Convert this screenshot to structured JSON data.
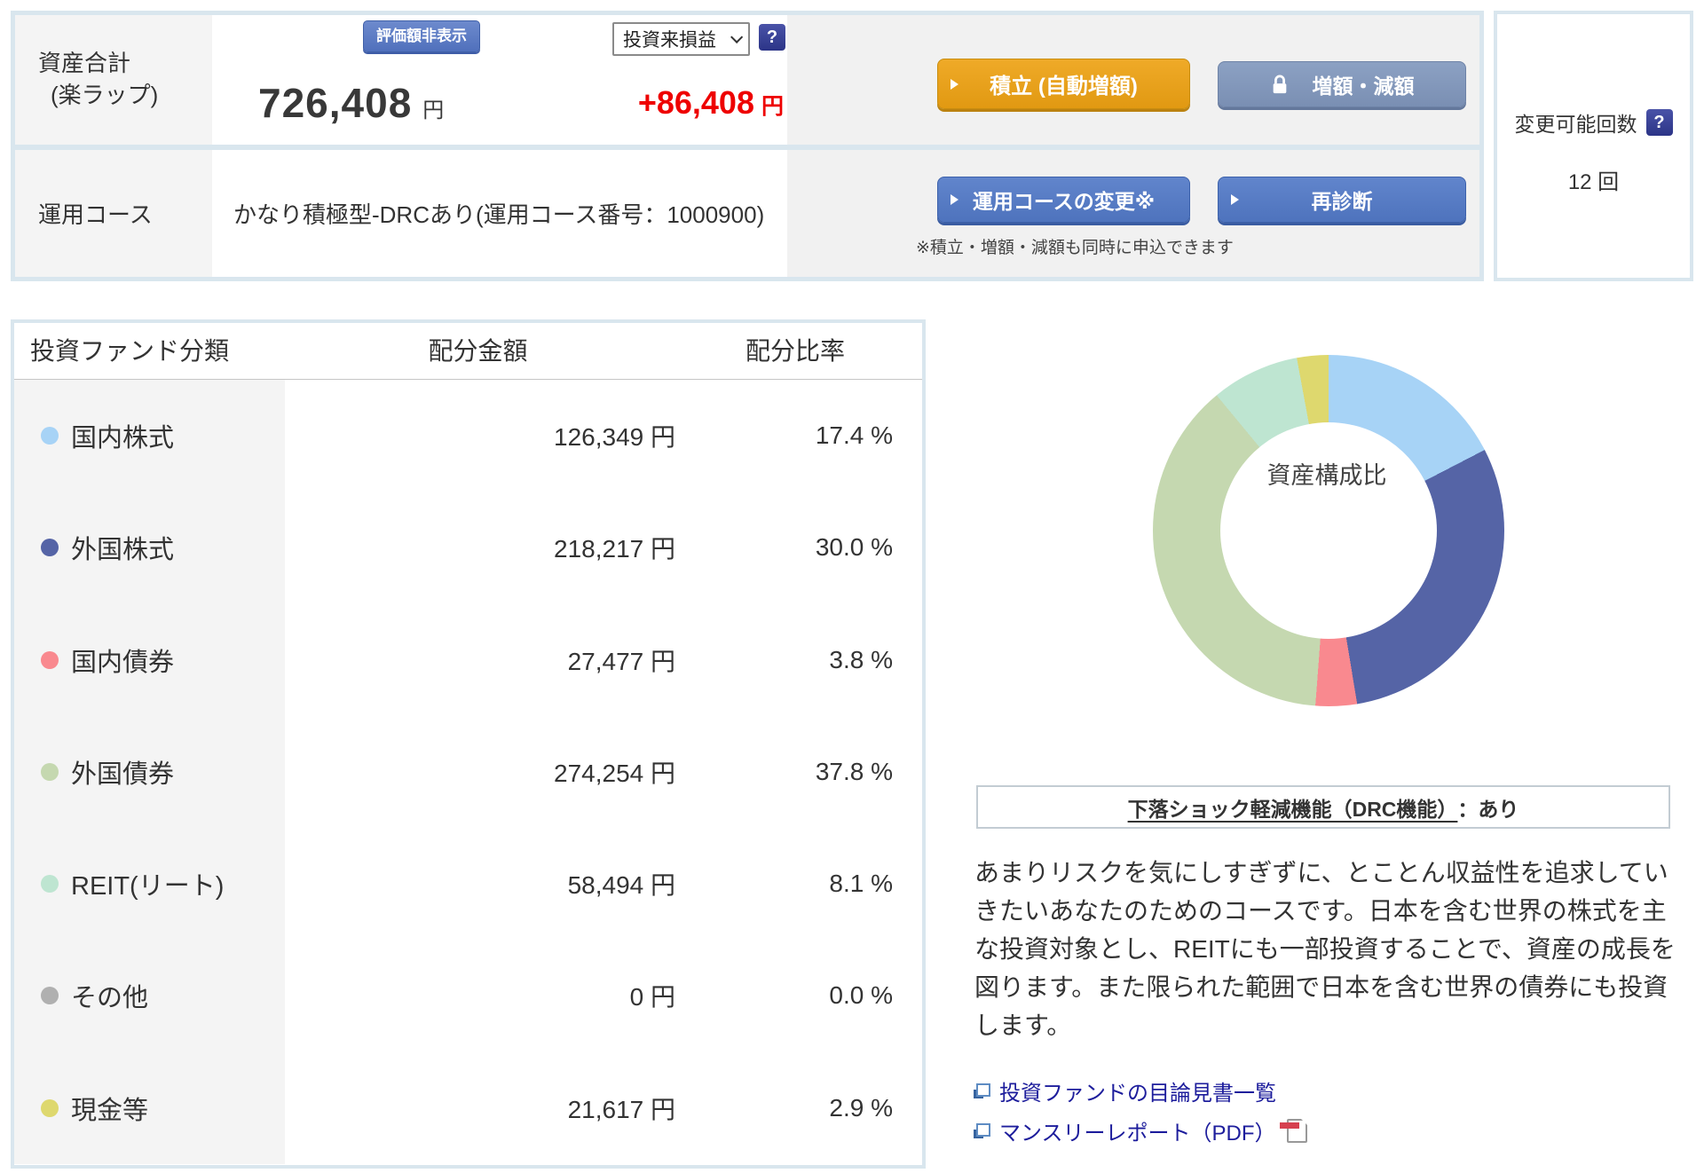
{
  "summary": {
    "asset_label_line1": "資産合計",
    "asset_label_line2": "(楽ラップ)",
    "hide_value_button": "評価額非表示",
    "total_value": "726,408",
    "total_unit": "円",
    "pl_select_value": "投資来損益",
    "pl_value": "+86,408",
    "pl_unit": "円",
    "help_icon": "?",
    "tsumitate_button": "積立 (自動増額)",
    "zougaku_button": "増額・減額",
    "note": "※積立・増額・減額も同時に申込できます",
    "course_label": "運用コース",
    "course_value": "かなり積極型-DRCあり(運用コース番号：1000900)",
    "course_change_button": "運用コースの変更※",
    "rediagnosis_button": "再診断",
    "changes_label": "変更可能回数",
    "changes_value": "12 回"
  },
  "allocation_table": {
    "headers": [
      "投資ファンド分類",
      "配分金額",
      "配分比率"
    ],
    "rows": [
      {
        "label": "国内株式",
        "amount": "126,349 円",
        "ratio": "17.4 %",
        "color": "#a7d3f6"
      },
      {
        "label": "外国株式",
        "amount": "218,217 円",
        "ratio": "30.0 %",
        "color": "#5564a6"
      },
      {
        "label": "国内債券",
        "amount": "27,477 円",
        "ratio": "3.8 %",
        "color": "#f9898f"
      },
      {
        "label": "外国債券",
        "amount": "274,254 円",
        "ratio": "37.8 %",
        "color": "#c5d8b0"
      },
      {
        "label": "REIT(リート)",
        "amount": "58,494 円",
        "ratio": "8.1 %",
        "color": "#bee5d1"
      },
      {
        "label": "その他",
        "amount": "0 円",
        "ratio": "0.0 %",
        "color": "#b0b0b0"
      },
      {
        "label": "現金等",
        "amount": "21,617 円",
        "ratio": "2.9 %",
        "color": "#ded86e"
      }
    ]
  },
  "chart_data": {
    "type": "pie",
    "variant": "donut",
    "title": "資産構成比",
    "labels": [
      "国内株式",
      "外国株式",
      "国内債券",
      "外国債券",
      "REIT(リート)",
      "その他",
      "現金等"
    ],
    "values": [
      17.4,
      30.0,
      3.8,
      37.8,
      8.1,
      0.0,
      2.9
    ],
    "colors": [
      "#a7d3f6",
      "#5564a6",
      "#f9898f",
      "#c5d8b0",
      "#bee5d1",
      "#b0b0b0",
      "#ded86e"
    ],
    "inner_radius_ratio": 0.62,
    "start_angle_deg": 0,
    "direction": "clockwise",
    "legend_position": "none"
  },
  "drc": {
    "title": "下落ショック軽減機能（DRC機能）",
    "status": "：あり"
  },
  "course_description": "あまりリスクを気にしすぎずに、とことん収益性を追求していきたいあなたのためのコースです。日本を含む世界の株式を主な投資対象とし、REITにも一部投資することで、資産の成長を図ります。また限られた範囲で日本を含む世界の債券にも投資します。",
  "links": [
    {
      "label": "投資ファンドの目論見書一覧"
    },
    {
      "label": "マンスリーレポート（PDF）"
    }
  ]
}
